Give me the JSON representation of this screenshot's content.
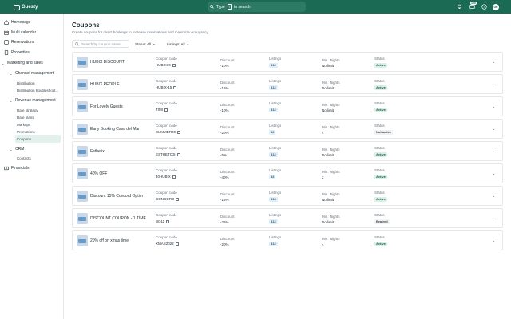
{
  "header": {
    "brand": "Guesty",
    "search_text": "Type",
    "search_key": "/",
    "search_suffix": "to search",
    "notif_badge": "100",
    "avatar_initials": "UR"
  },
  "sidebar": {
    "items": [
      {
        "label": "Homepage"
      },
      {
        "label": "Multi calendar"
      },
      {
        "label": "Reservations"
      },
      {
        "label": "Properties"
      },
      {
        "label": "Marketing and sales"
      },
      {
        "label": "Channel management"
      },
      {
        "label": "Distribution"
      },
      {
        "label": "Distribution troubleshoot..."
      },
      {
        "label": "Revenue management"
      },
      {
        "label": "Rate strategy"
      },
      {
        "label": "Rate plans"
      },
      {
        "label": "Markups"
      },
      {
        "label": "Promotions"
      },
      {
        "label": "Coupons"
      },
      {
        "label": "CRM"
      },
      {
        "label": "Contacts"
      },
      {
        "label": "Financials"
      }
    ]
  },
  "page": {
    "title": "Coupons",
    "subtitle": "Create coupons for direct bookings to increase reservations and maximize occupancy.",
    "search_placeholder": "Search by coupon name",
    "filter_status": "Status: All",
    "filter_listings": "Listings: All"
  },
  "labels": {
    "code": "Coupon code",
    "discount": "Discount",
    "listings": "Listings",
    "min_nights": "Min. Nights",
    "status": "Status"
  },
  "coupons": [
    {
      "name": "HUBIX DISCOUNT",
      "code": "HUBIX10",
      "discount": "-10%",
      "listings": "412",
      "min_nights": "No limit",
      "status": "Active"
    },
    {
      "name": "HUBIX PEOPLE",
      "code": "HUBIX-15",
      "discount": "-15%",
      "listings": "412",
      "min_nights": "No limit",
      "status": "Active"
    },
    {
      "name": "For Lovely Guests",
      "code": "TIMI",
      "discount": "-10%",
      "listings": "412",
      "min_nights": "No limit",
      "status": "Active"
    },
    {
      "name": "Early Booking Casa del Mar",
      "code": "SUMMER20",
      "discount": "-20%",
      "listings": "82",
      "min_nights": "4",
      "status": "Not active"
    },
    {
      "name": "Esthetix",
      "code": "ESTHETIX5",
      "discount": "-5%",
      "listings": "412",
      "min_nights": "No limit",
      "status": "Active"
    },
    {
      "name": "40% OFF",
      "code": "40HUBIX",
      "discount": "-40%",
      "listings": "82",
      "min_nights": "2",
      "status": "Active"
    },
    {
      "name": "Discount 15% Concord Optim",
      "code": "CONCORD",
      "discount": "-15%",
      "listings": "413",
      "min_nights": "No limit",
      "status": "Active"
    },
    {
      "name": "DISCOUNT COUPON - 1 TIME",
      "code": "BO11",
      "discount": "-25%",
      "listings": "412",
      "min_nights": "No limit",
      "status": "Expired"
    },
    {
      "name": "20% off on xmas time",
      "code": "XMAS2022",
      "discount": "-20%",
      "listings": "412",
      "min_nights": "4",
      "status": "Active"
    }
  ]
}
